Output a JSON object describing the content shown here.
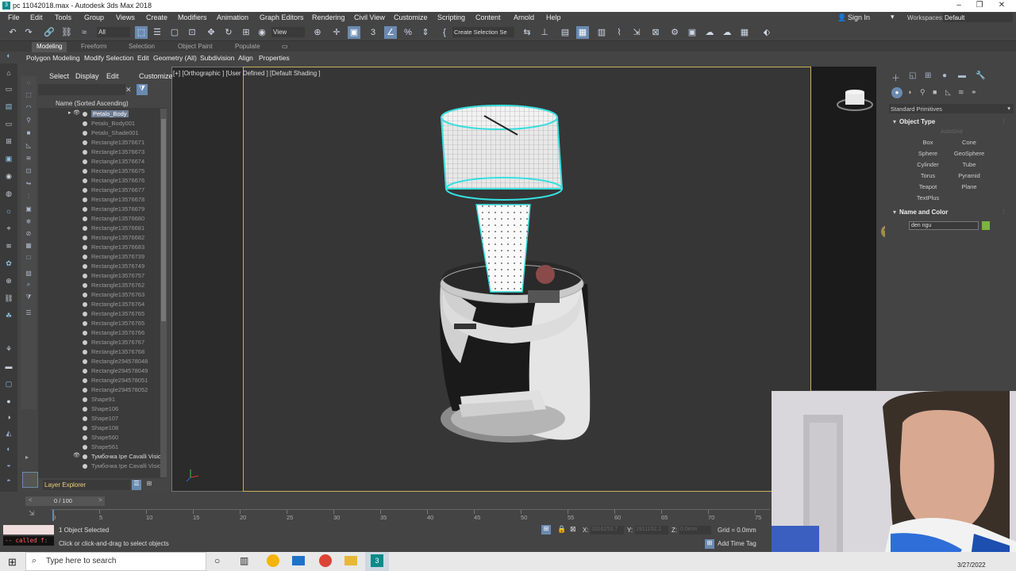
{
  "window": {
    "title": "pc 11042018.max - Autodesk 3ds Max 2018",
    "icon": "3ds-max-icon"
  },
  "menu": [
    "File",
    "Edit",
    "Tools",
    "Group",
    "Views",
    "Create",
    "Modifiers",
    "Animation",
    "Graph Editors",
    "Rendering",
    "Civil View",
    "Customize",
    "Scripting",
    "Content",
    "Arnold",
    "Help"
  ],
  "user": {
    "sign_in": "Sign In",
    "workspaces_label": "Workspaces:",
    "workspace": "Default"
  },
  "toolbar": {
    "selection_filter": "All",
    "ref_coord": "View",
    "named_selection": "Create Selection Se"
  },
  "ribbon": {
    "tabs": [
      "Modeling",
      "Freeform",
      "Selection",
      "Object Paint",
      "Populate"
    ],
    "sub": [
      "Polygon Modeling",
      "Modify Selection",
      "Edit",
      "Geometry (All)",
      "Subdivision",
      "Align",
      "Properties"
    ]
  },
  "scene_explorer": {
    "menu": [
      "Select",
      "Display",
      "Edit",
      "Customize"
    ],
    "column_header": "Name (Sorted Ascending)",
    "rows": [
      {
        "name": "Petalo_Body",
        "selected": true,
        "eye": true
      },
      {
        "name": "Petalo_Body001"
      },
      {
        "name": "Petalo_Shade001"
      },
      {
        "name": "Rectangle13576671"
      },
      {
        "name": "Rectangle13576673"
      },
      {
        "name": "Rectangle13576674"
      },
      {
        "name": "Rectangle13576675"
      },
      {
        "name": "Rectangle13576676"
      },
      {
        "name": "Rectangle13576677"
      },
      {
        "name": "Rectangle13576678"
      },
      {
        "name": "Rectangle13576679"
      },
      {
        "name": "Rectangle13576680"
      },
      {
        "name": "Rectangle13576681"
      },
      {
        "name": "Rectangle13576682"
      },
      {
        "name": "Rectangle13576683"
      },
      {
        "name": "Rectangle13576739"
      },
      {
        "name": "Rectangle13576749"
      },
      {
        "name": "Rectangle13576757"
      },
      {
        "name": "Rectangle13576762"
      },
      {
        "name": "Rectangle13576763"
      },
      {
        "name": "Rectangle13576764"
      },
      {
        "name": "Rectangle13576765"
      },
      {
        "name": "Rectangle13576765"
      },
      {
        "name": "Rectangle13576766"
      },
      {
        "name": "Rectangle13576767"
      },
      {
        "name": "Rectangle13576768"
      },
      {
        "name": "Rectangle294578048"
      },
      {
        "name": "Rectangle294578049"
      },
      {
        "name": "Rectangle294578051"
      },
      {
        "name": "Rectangle294578052"
      },
      {
        "name": "Shape91"
      },
      {
        "name": "Shape106"
      },
      {
        "name": "Shape107"
      },
      {
        "name": "Shape108"
      },
      {
        "name": "Shape560"
      },
      {
        "name": "Shape561"
      },
      {
        "name": "Тумбочка Ipe Cavalli Visio",
        "eye": true,
        "bright": true
      },
      {
        "name": "Тумбочка Ipe Cavalli Visio"
      }
    ],
    "footer": "Layer Explorer"
  },
  "viewport": {
    "label": "[+] [Orthographic ] [User Defined ] [Default Shading ]"
  },
  "command_panel": {
    "dropdown": "Standard Primitives",
    "object_type_title": "Object Type",
    "autogrid": "AutoGrid",
    "buttons": [
      "Box",
      "Cone",
      "Sphere",
      "GeoSphere",
      "Cylinder",
      "Tube",
      "Torus",
      "Pyramid",
      "Teapot",
      "Plane",
      "TextPlus"
    ],
    "name_color_title": "Name and Color",
    "object_name": "den ngu",
    "object_color": "#7cb342"
  },
  "timeline": {
    "frame": "0 / 100",
    "ticks": [
      "0",
      "5",
      "10",
      "15",
      "20",
      "25",
      "30",
      "35",
      "40",
      "45",
      "50",
      "55",
      "60",
      "65",
      "70",
      "75"
    ]
  },
  "status": {
    "script": "-- called f:",
    "selected": "1 Object Selected",
    "prompt": "Click or click-and-drag to select objects",
    "x_label": "X:",
    "x_value": "3316253.7",
    "y_label": "Y:",
    "y_value": "1911152.1",
    "z_label": "Z:",
    "z_value": "0.0mm",
    "grid": "Grid = 0.0mm",
    "time_tag": "Add Time Tag"
  },
  "taskbar": {
    "search_placeholder": "Type here to search",
    "date": "3/27/2022"
  },
  "colors": {
    "accent": "#6a8ab0",
    "viewport_border": "#c8b25a",
    "lamp_wire": "#35e0e0"
  }
}
